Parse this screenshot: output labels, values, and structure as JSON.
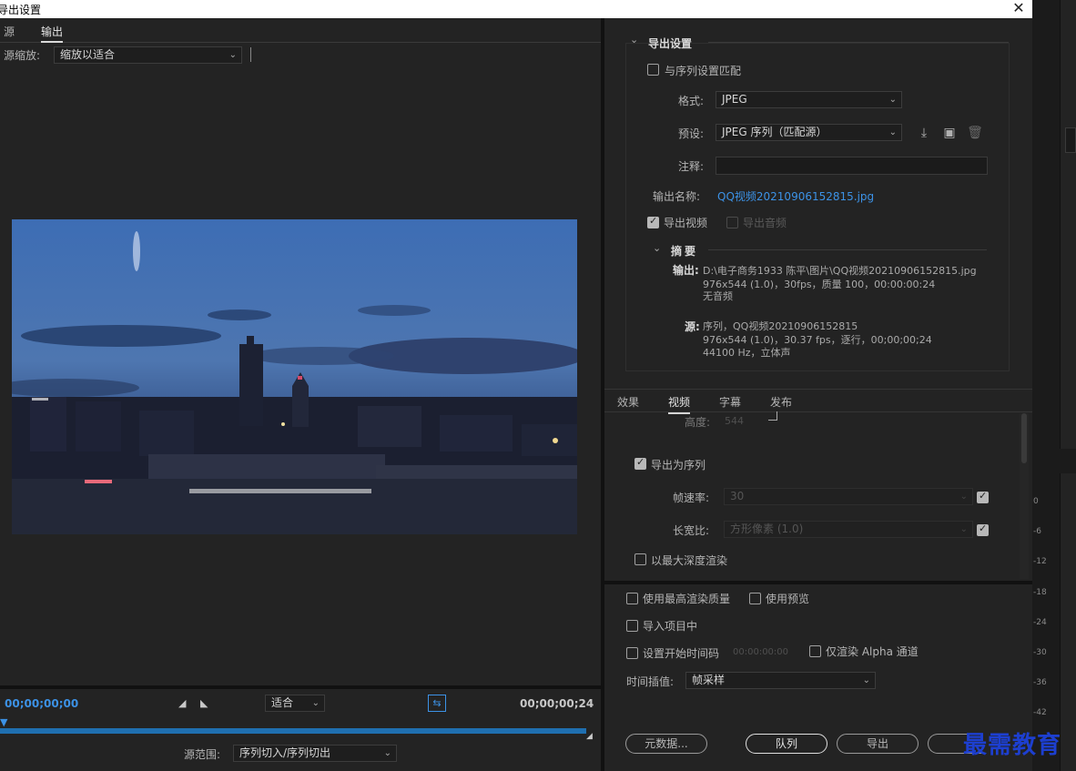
{
  "window": {
    "title": "导出设置",
    "close_glyph": "✕"
  },
  "left": {
    "tabs": [
      {
        "label": "源"
      },
      {
        "label": "输出"
      }
    ],
    "zoom": {
      "label": "源缩放:",
      "value": "缩放以适合"
    },
    "timecode_start": "00;00;00;00",
    "timecode_end": "00;00;00;24",
    "fit": {
      "value": "适合"
    },
    "range": {
      "label": "源范围:",
      "value": "序列切入/序列切出"
    }
  },
  "export": {
    "section_title": "导出设置",
    "match_sequence_label": "与序列设置匹配",
    "match_sequence_checked": false,
    "format_label": "格式:",
    "format_value": "JPEG",
    "preset_label": "预设:",
    "preset_value": "JPEG 序列（匹配源）",
    "comment_label": "注释:",
    "comment_value": "",
    "output_name_label": "输出名称:",
    "output_name_value": "QQ视频20210906152815.jpg",
    "export_video_label": "导出视频",
    "export_video_checked": true,
    "export_audio_label": "导出音频",
    "export_audio_checked": false,
    "summary_title": "摘要",
    "summary_output_label": "输出:",
    "summary_output_line1": "D:\\电子商务1933 陈平\\图片\\QQ视频20210906152815.jpg",
    "summary_output_line2": "976x544 (1.0)，30fps，质量 100，00:00:00:24",
    "summary_output_line3": "无音频",
    "summary_source_label": "源:",
    "summary_source_line1": "序列，QQ视频20210906152815",
    "summary_source_line2": "976x544 (1.0)，30.37 fps，逐行，00;00;00;24",
    "summary_source_line3": "44100 Hz，立体声"
  },
  "tabs2": [
    {
      "label": "效果"
    },
    {
      "label": "视频"
    },
    {
      "label": "字幕"
    },
    {
      "label": "发布"
    }
  ],
  "video": {
    "height_label": "高度:",
    "height_value": "544",
    "export_as_sequence_label": "导出为序列",
    "export_as_sequence_checked": true,
    "framerate_label": "帧速率:",
    "framerate_value": "30",
    "aspect_label": "长宽比:",
    "aspect_value": "方形像素 (1.0)",
    "max_depth_label": "以最大深度渲染"
  },
  "bottom": {
    "max_quality_label": "使用最高渲染质量",
    "use_previews_label": "使用预览",
    "import_project_label": "导入项目中",
    "set_start_tc_label": "设置开始时间码",
    "start_tc_value": "00:00:00:00",
    "alpha_only_label": "仅渲染 Alpha 通道",
    "interp_label": "时间插值:",
    "interp_value": "帧采样",
    "metadata_button": "元数据...",
    "queue_button": "队列",
    "export_button": "导出"
  },
  "meter_ticks": [
    "0",
    "-6",
    "-12",
    "-18",
    "-24",
    "-30",
    "-36",
    "-42"
  ],
  "watermark": "最需教育",
  "colors": {
    "accent": "#3c92e6",
    "progress": "#1f6fb0",
    "watermark": "#1d3fd0"
  }
}
